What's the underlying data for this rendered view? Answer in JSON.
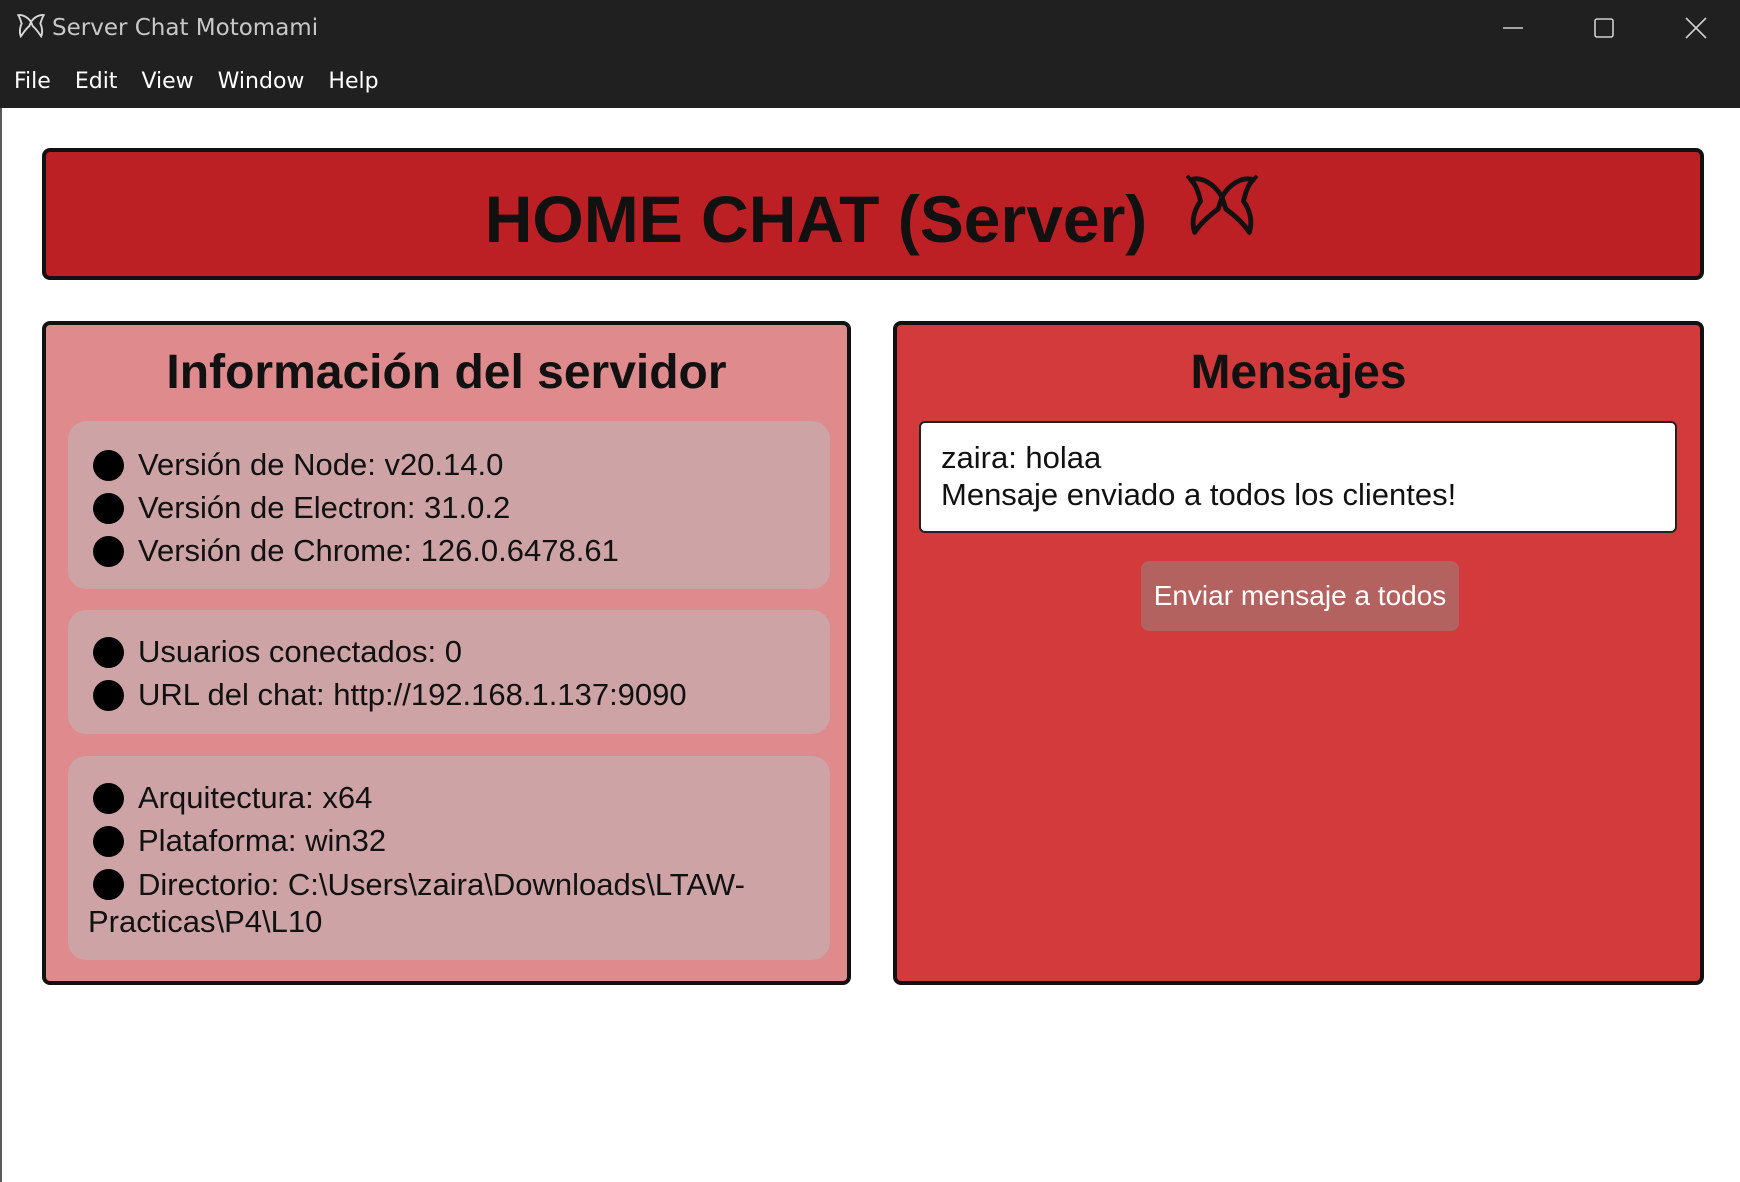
{
  "window": {
    "title": "Server Chat Motomami",
    "controls": [
      "minimize-icon",
      "maximize-icon",
      "close-icon"
    ]
  },
  "menu": {
    "items": [
      "File",
      "Edit",
      "View",
      "Window",
      "Help"
    ]
  },
  "header": {
    "title": "HOME CHAT (Server)",
    "logo_icon": "butterfly-icon"
  },
  "server_info": {
    "title": "Información del servidor",
    "group1": [
      "Versión de Node: v20.14.0",
      "Versión de Electron: 31.0.2",
      "Versión de Chrome: 126.0.6478.61"
    ],
    "group2": [
      "Usuarios conectados: 0",
      "URL del chat: http://192.168.1.137:9090"
    ],
    "group3": [
      "Arquitectura: x64",
      "Plataforma: win32",
      "Directorio: C:\\Users\\zaira\\Downloads\\LTAW-Practicas\\P4\\L10"
    ]
  },
  "messages": {
    "title": "Mensajes",
    "lines": [
      "zaira: holaa",
      "Mensaje enviado a todos los clientes!"
    ],
    "send_button": "Enviar mensaje a todos"
  },
  "colors": {
    "titlebar": "#202020",
    "banner": "#bd2024",
    "info_panel": "#df8a8c",
    "info_box": "#cda3a5",
    "messages_panel": "#d33a3c",
    "send_button": "#b3625f"
  }
}
